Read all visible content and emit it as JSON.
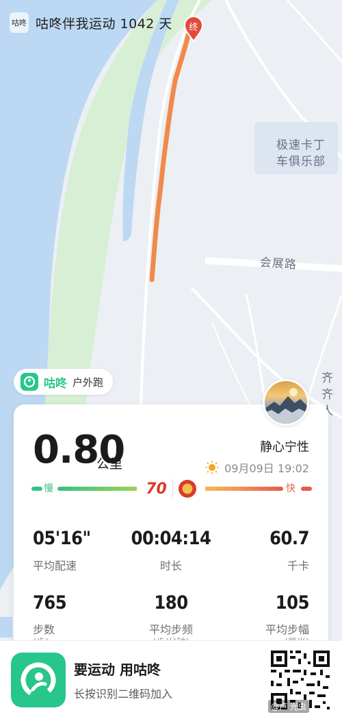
{
  "header": {
    "logo_text": "咕咚",
    "title": "咕咚伴我运动 1042 天"
  },
  "map": {
    "end_marker": "终",
    "labels": {
      "club": "极速卡丁车俱乐部",
      "club_line1": "极速卡丁",
      "club_line2": "车俱乐部",
      "road": "会展路",
      "cut_line1": "齐齐",
      "cut_line2": "人"
    }
  },
  "badge": {
    "app": "咕咚",
    "type": "户外跑"
  },
  "card": {
    "distance": "0.80",
    "distance_unit": "公里",
    "username": "静心宁性",
    "datetime": "09月09日 19:02",
    "pace_slow": "慢",
    "pace_fast": "快",
    "logo_70": "70",
    "stats": [
      {
        "value": "05'16\"",
        "label": "平均配速"
      },
      {
        "value": "00:04:14",
        "label": "时长"
      },
      {
        "value": "60.7",
        "label": "千卡"
      },
      {
        "value": "765",
        "label": "步数",
        "sub": "(步)"
      },
      {
        "value": "180",
        "label": "平均步频",
        "sub": "(步/分钟)"
      },
      {
        "value": "105",
        "label": "平均步幅",
        "sub": "(厘米)"
      }
    ]
  },
  "footer": {
    "title": "要运动 用咕咚",
    "subtitle": "长按识别二维码加入",
    "watermark": "@卢 光虫"
  },
  "colors": {
    "brand_green": "#27c68a",
    "route_orange": "#f08a4b",
    "river_blue": "#bcd8f3",
    "park_green": "#d7efd5"
  },
  "icons": [
    "end-marker-icon",
    "sun-icon",
    "app-logo-icon",
    "qr-code"
  ]
}
